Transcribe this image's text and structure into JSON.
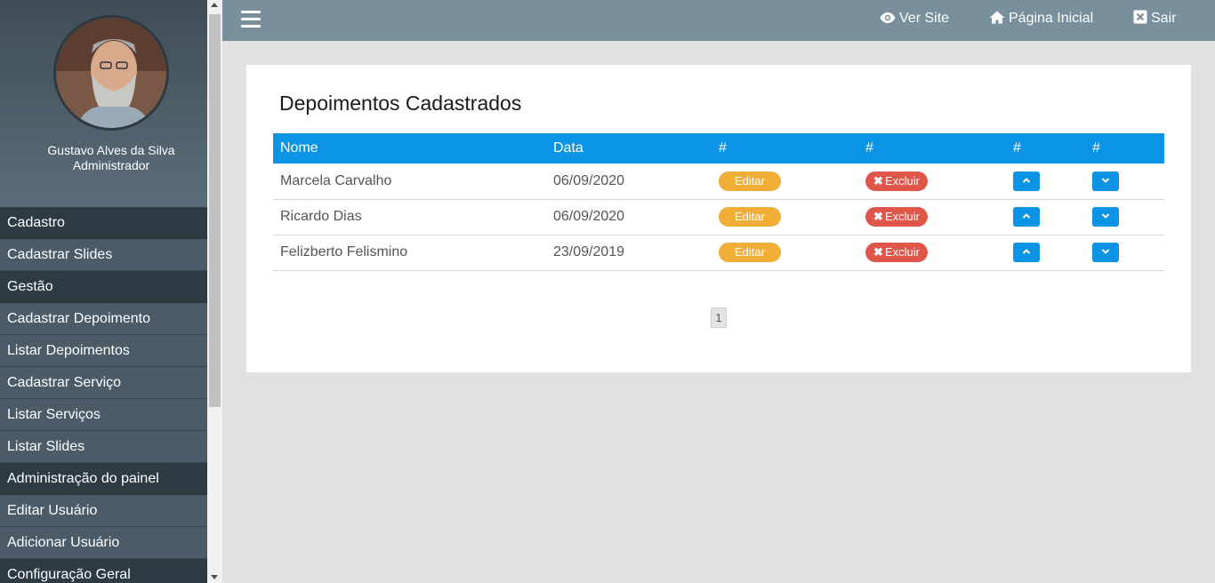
{
  "sidebar": {
    "user_name": "Gustavo Alves da Silva",
    "user_role": "Administrador",
    "menu": [
      {
        "type": "header",
        "label": "Cadastro"
      },
      {
        "type": "item",
        "label": "Cadastrar Slides"
      },
      {
        "type": "header",
        "label": "Gestão"
      },
      {
        "type": "item",
        "label": "Cadastrar Depoimento"
      },
      {
        "type": "item",
        "label": "Listar Depoimentos"
      },
      {
        "type": "item",
        "label": "Cadastrar Serviço"
      },
      {
        "type": "item",
        "label": "Listar Serviços"
      },
      {
        "type": "item",
        "label": "Listar Slides"
      },
      {
        "type": "header",
        "label": "Administração do painel"
      },
      {
        "type": "item",
        "label": "Editar Usuário"
      },
      {
        "type": "item",
        "label": "Adicionar Usuário"
      },
      {
        "type": "header",
        "label": "Configuração Geral"
      }
    ]
  },
  "topbar": {
    "ver_site": "Ver Site",
    "pagina_inicial": "Página Inicial",
    "sair": "Sair"
  },
  "main": {
    "title": "Depoimentos Cadastrados",
    "table": {
      "headers": [
        "Nome",
        "Data",
        "#",
        "#",
        "#",
        "#"
      ],
      "rows": [
        {
          "nome": "Marcela Carvalho",
          "data": "06/09/2020"
        },
        {
          "nome": "Ricardo Dias",
          "data": "06/09/2020"
        },
        {
          "nome": "Felizberto Felismino",
          "data": "23/09/2019"
        }
      ],
      "edit_label": "Editar",
      "delete_label": "Excluir"
    },
    "pagination": {
      "current_page": "1"
    }
  },
  "colors": {
    "sidebar": "#43525d",
    "topbar": "#7a8f9c",
    "table_header": "#0b93e6",
    "edit": "#f0ad38",
    "delete": "#e0564b"
  }
}
